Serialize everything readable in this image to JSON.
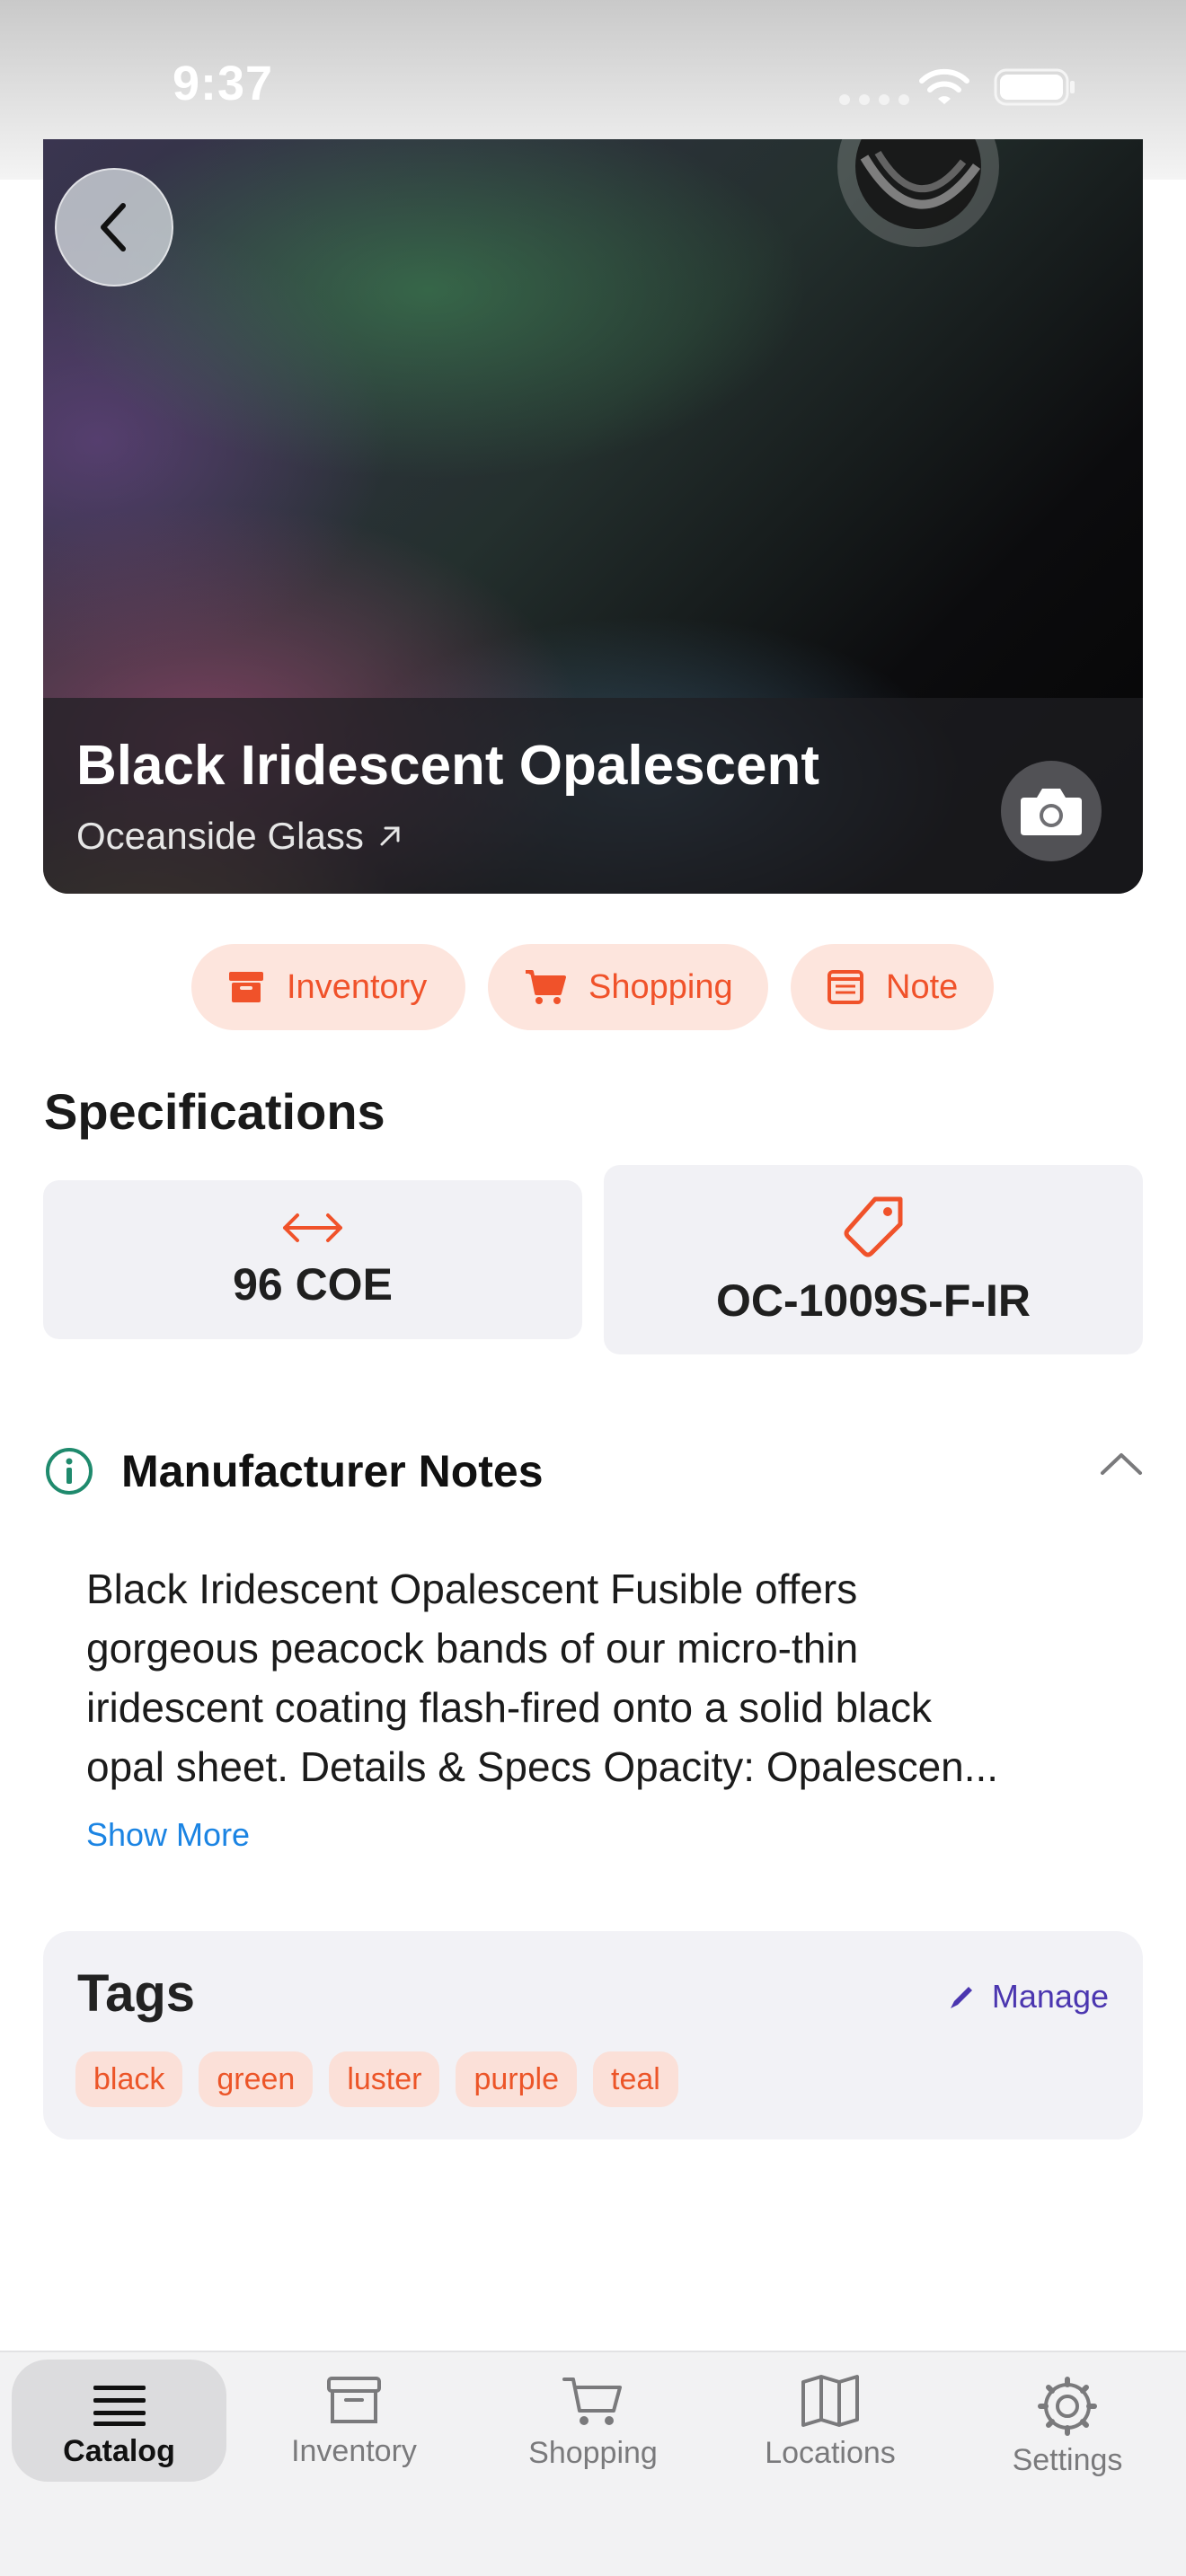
{
  "status_bar": {
    "time": "9:37"
  },
  "product": {
    "title": "Black Iridescent Opalescent",
    "manufacturer": "Oceanside Glass"
  },
  "actions": [
    {
      "label": "Inventory",
      "icon": "archive-box-icon"
    },
    {
      "label": "Shopping",
      "icon": "cart-icon"
    },
    {
      "label": "Note",
      "icon": "note-icon"
    }
  ],
  "specifications": {
    "title": "Specifications",
    "coe": {
      "value": "96 COE",
      "icon": "arrows-horizontal-icon"
    },
    "sku": {
      "value": "OC-1009S-F-IR",
      "icon": "tag-icon"
    }
  },
  "manufacturer_notes": {
    "title": "Manufacturer Notes",
    "body_lines": [
      "Black Iridescent Opalescent Fusible offers",
      "gorgeous peacock bands of our micro-thin",
      "iridescent coating flash-fired onto a solid black",
      "opal sheet. Details & Specs Opacity: Opalescen..."
    ],
    "show_more": "Show More"
  },
  "tags": {
    "title": "Tags",
    "manage_label": "Manage",
    "items": [
      "black",
      "green",
      "luster",
      "purple",
      "teal"
    ]
  },
  "tab_bar": {
    "items": [
      {
        "label": "Catalog",
        "icon": "list-icon",
        "active": true
      },
      {
        "label": "Inventory",
        "icon": "archive-box-icon",
        "active": false
      },
      {
        "label": "Shopping",
        "icon": "cart-icon",
        "active": false
      },
      {
        "label": "Locations",
        "icon": "map-icon",
        "active": false
      },
      {
        "label": "Settings",
        "icon": "gear-icon",
        "active": false
      }
    ]
  },
  "colors": {
    "accent": "#f0522a",
    "chip_background": "#fde5dd",
    "link": "#1b84e3",
    "manage": "#4b36b0",
    "info_icon": "#1f8a6d"
  }
}
